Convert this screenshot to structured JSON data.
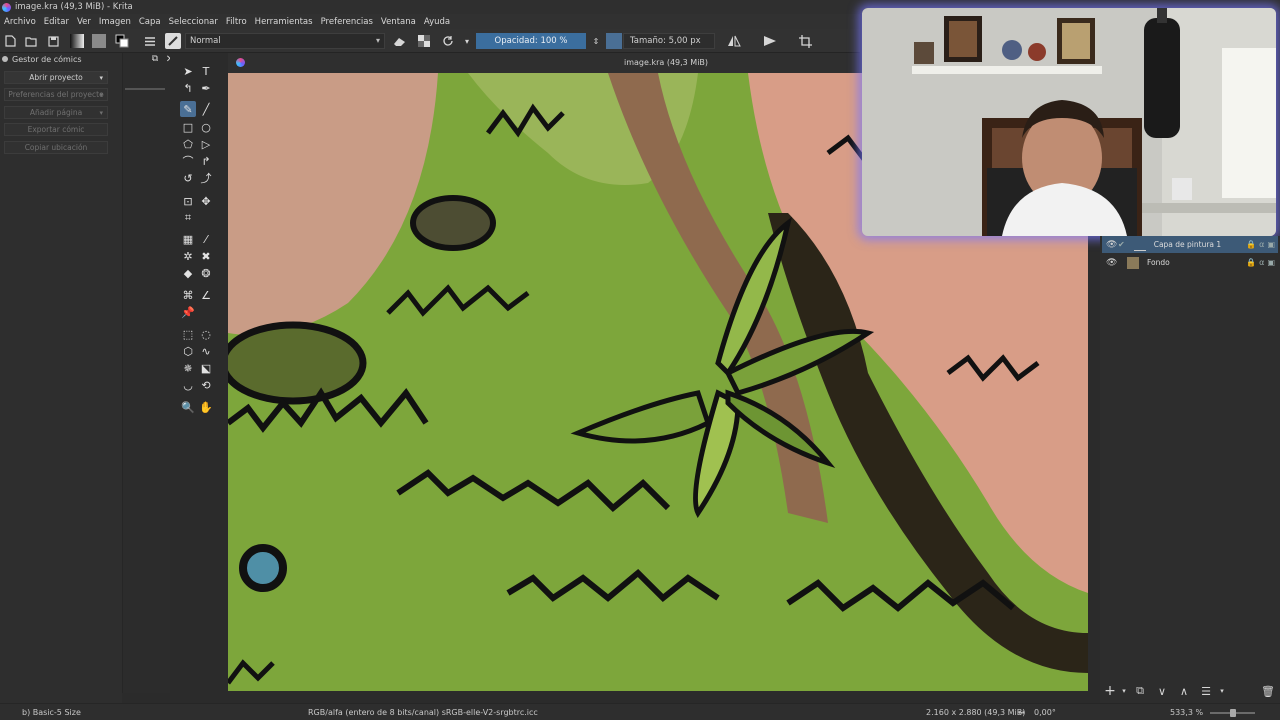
{
  "window": {
    "title": "image.kra (49,3 MiB) - Krita"
  },
  "menu": [
    "Archivo",
    "Editar",
    "Ver",
    "Imagen",
    "Capa",
    "Seleccionar",
    "Filtro",
    "Herramientas",
    "Preferencias",
    "Ventana",
    "Ayuda"
  ],
  "toolbar": {
    "blend_mode": "Normal",
    "opacity_label": "Opacidad: 100 %",
    "size_label": "Tamaño: 5,00 px",
    "icons": [
      "new-document-icon",
      "open-icon",
      "save-icon",
      "gradient-icon",
      "pattern-icon",
      "color-swap-icon",
      "brush-preset-icon",
      "eraser-icon",
      "alpha-lock-icon",
      "reload-icon",
      "mirror-horizontal-icon",
      "mirror-vertical-icon",
      "wrap-icon"
    ]
  },
  "comics_manager": {
    "title": "Gestor de cómics",
    "buttons": [
      "Abrir proyecto",
      "Preferencias del proyecto",
      "Añadir página",
      "Exportar cómic",
      "Copiar ubicación"
    ]
  },
  "canvas": {
    "document_name": "image.kra (49,3 MiB)"
  },
  "layers": [
    {
      "name": "Capa de pintura 1",
      "selected": true
    },
    {
      "name": "Fondo",
      "selected": false
    }
  ],
  "status": {
    "brush_preset": "b) Basic-5 Size",
    "color_space": "RGB/alfa (entero de 8 bits/canal)  sRGB-elle-V2-srgbtrc.icc",
    "dimensions": "2.160 x 2.880 (49,3 MiB)",
    "rotation": "0,00°",
    "zoom": "533,3 %"
  },
  "colors": {
    "accent": "#3b6e9e",
    "layer_selected": "#3d5a77",
    "background": "#2b2b2b",
    "webcam_glow": "#7878ff"
  }
}
